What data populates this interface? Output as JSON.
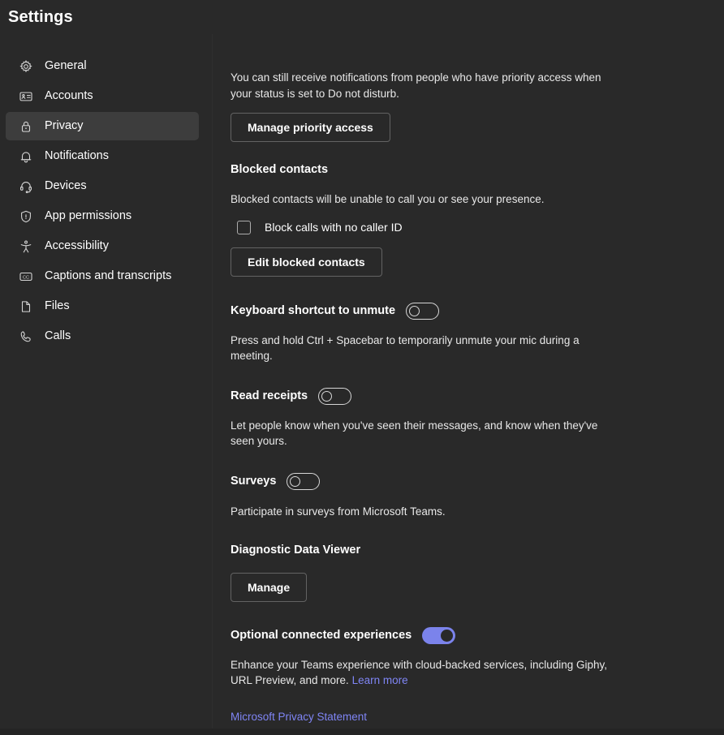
{
  "window": {
    "title": "Settings",
    "accent_color": "#7b83eb",
    "link_color": "#7f85f5",
    "background_color": "#292929",
    "selected_item_color": "#3d3d3d"
  },
  "sidebar": {
    "items": [
      {
        "label": "General",
        "icon": "gear-icon",
        "selected": false
      },
      {
        "label": "Accounts",
        "icon": "id-card-icon",
        "selected": false
      },
      {
        "label": "Privacy",
        "icon": "lock-icon",
        "selected": true
      },
      {
        "label": "Notifications",
        "icon": "bell-icon",
        "selected": false
      },
      {
        "label": "Devices",
        "icon": "headset-icon",
        "selected": false
      },
      {
        "label": "App permissions",
        "icon": "shield-icon",
        "selected": false
      },
      {
        "label": "Accessibility",
        "icon": "accessibility-icon",
        "selected": false
      },
      {
        "label": "Captions and transcripts",
        "icon": "closed-caption-icon",
        "selected": false
      },
      {
        "label": "Files",
        "icon": "file-icon",
        "selected": false
      },
      {
        "label": "Calls",
        "icon": "phone-icon",
        "selected": false
      }
    ]
  },
  "privacy": {
    "priority_access": {
      "description": "You can still receive notifications from people who have priority access when your status is set to Do not disturb.",
      "button_label": "Manage priority access"
    },
    "blocked_contacts": {
      "heading": "Blocked contacts",
      "description": "Blocked contacts will be unable to call you or see your presence.",
      "checkbox_label": "Block calls with no caller ID",
      "checkbox_checked": false,
      "button_label": "Edit blocked contacts"
    },
    "keyboard_shortcut": {
      "heading": "Keyboard shortcut to unmute",
      "toggle_state": "off",
      "description": "Press and hold Ctrl + Spacebar to temporarily unmute your mic during a meeting."
    },
    "read_receipts": {
      "heading": "Read receipts",
      "toggle_state": "off",
      "description": "Let people know when you've seen their messages, and know when they've seen yours."
    },
    "surveys": {
      "heading": "Surveys",
      "toggle_state": "off",
      "description": "Participate in surveys from Microsoft Teams."
    },
    "diagnostic_data_viewer": {
      "heading": "Diagnostic Data Viewer",
      "button_label": "Manage"
    },
    "optional_connected_experiences": {
      "heading": "Optional connected experiences",
      "toggle_state": "on",
      "description_part1": "Enhance your Teams experience with cloud-backed services, including Giphy, URL Preview, and more.",
      "learn_more_label": "Learn more"
    },
    "privacy_statement_link": "Microsoft Privacy Statement"
  }
}
